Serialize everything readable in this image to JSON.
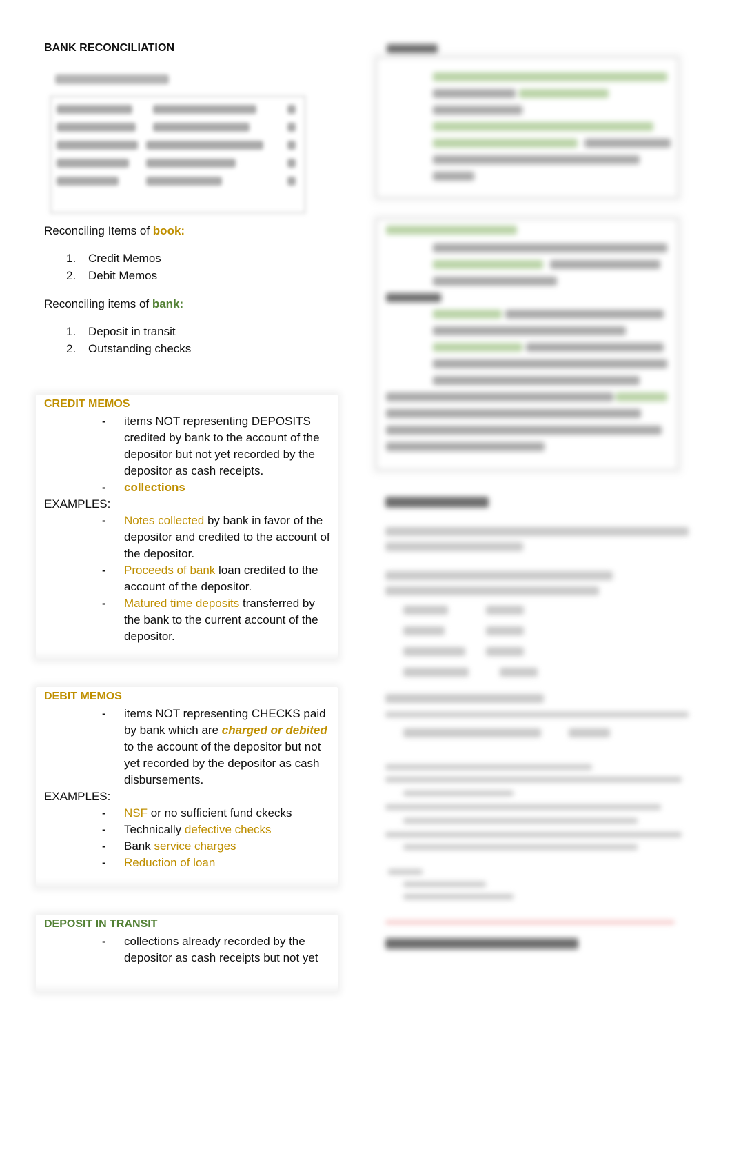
{
  "document": {
    "title": "BANK RECONCILIATION",
    "book_items": {
      "intro_prefix": "Reconciling Items of ",
      "intro_highlight": "book:",
      "items": [
        {
          "num": "1.",
          "label": "Credit Memos"
        },
        {
          "num": "2.",
          "label": "Debit Memos"
        }
      ]
    },
    "bank_items": {
      "intro_prefix": "Reconciling items of ",
      "intro_highlight": "bank:",
      "items": [
        {
          "num": "1.",
          "label": "Deposit in transit"
        },
        {
          "num": "2.",
          "label": "Outstanding checks"
        }
      ]
    },
    "credit_memos": {
      "heading": "CREDIT MEMOS",
      "definition": "items NOT representing DEPOSITS credited by bank to the account of the depositor but not yet recorded by the depositor as cash receipts.",
      "keyword": "collections",
      "examples_label": "EXAMPLES:",
      "examples": [
        {
          "highlight": "Notes collected",
          "rest": " by bank in favor of the depositor and credited to the account of the depositor."
        },
        {
          "highlight": "Proceeds of bank",
          "rest": " loan credited to the account of the depositor."
        },
        {
          "highlight": "Matured time deposits",
          "rest": " transferred by the bank to the current account of the depositor."
        }
      ]
    },
    "debit_memos": {
      "heading": "DEBIT MEMOS",
      "definition_prefix": "items NOT representing CHECKS paid by bank which are ",
      "definition_highlight": "charged or debited",
      "definition_suffix": " to the account of the depositor but not yet recorded by the depositor as cash disbursements.",
      "examples_label": "EXAMPLES:",
      "examples": [
        {
          "prefix": "",
          "highlight": "NSF",
          "rest": " or no sufficient fund ckecks"
        },
        {
          "prefix": "Technically ",
          "highlight": "defective checks",
          "rest": ""
        },
        {
          "prefix": "Bank ",
          "highlight": "service charges",
          "rest": ""
        },
        {
          "prefix": "",
          "highlight": "Reduction of loan",
          "rest": ""
        }
      ]
    },
    "deposit_in_transit": {
      "heading": "DEPOSIT IN TRANSIT",
      "definition": "collections already recorded by the depositor as cash receipts but not yet"
    },
    "bullet_dash": "-"
  },
  "colors": {
    "gold": "#bf8f00",
    "green": "#538135"
  }
}
